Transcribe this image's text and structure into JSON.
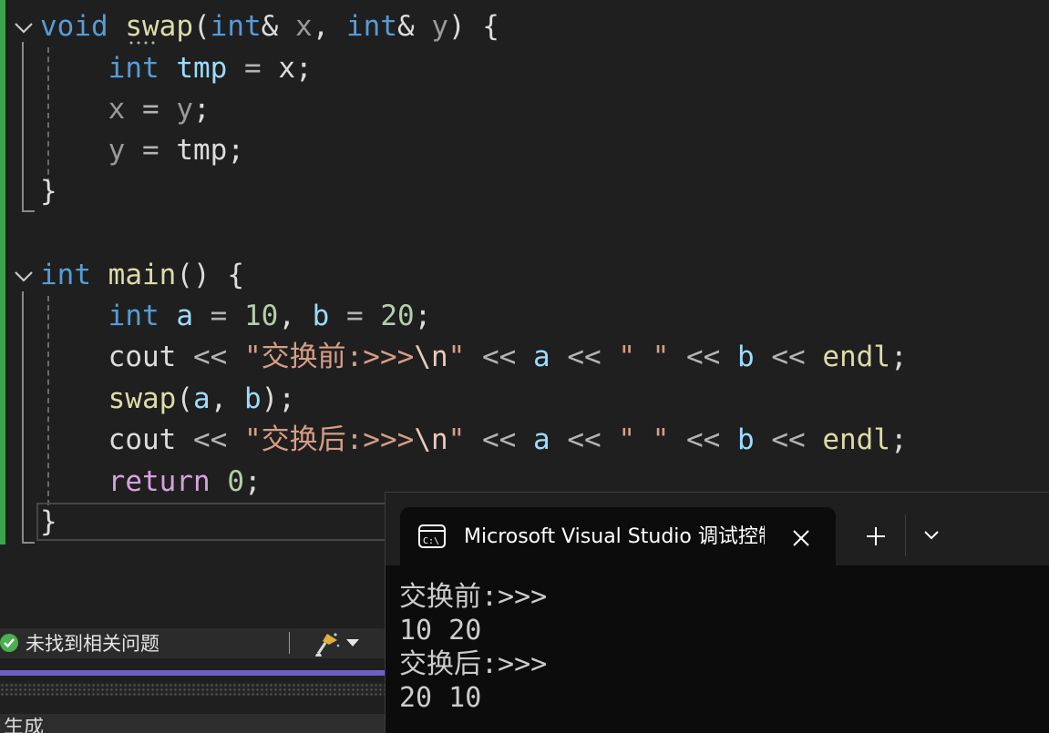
{
  "editor": {
    "lines": [
      {
        "segments": [
          {
            "cls": "kw",
            "text": "void"
          },
          {
            "cls": "",
            "text": " "
          },
          {
            "cls": "fn",
            "text": "swap"
          },
          {
            "cls": "",
            "text": "("
          },
          {
            "cls": "kw",
            "text": "int"
          },
          {
            "cls": "",
            "text": "& "
          },
          {
            "cls": "par",
            "text": "x"
          },
          {
            "cls": "",
            "text": ", "
          },
          {
            "cls": "kw",
            "text": "int"
          },
          {
            "cls": "",
            "text": "& "
          },
          {
            "cls": "par",
            "text": "y"
          },
          {
            "cls": "",
            "text": ") {"
          }
        ]
      },
      {
        "segments": [
          {
            "cls": "",
            "text": "    "
          },
          {
            "cls": "kw",
            "text": "int"
          },
          {
            "cls": "",
            "text": " "
          },
          {
            "cls": "var",
            "text": "tmp"
          },
          {
            "cls": "op",
            "text": " = "
          },
          {
            "cls": "",
            "text": "x;"
          }
        ]
      },
      {
        "segments": [
          {
            "cls": "",
            "text": "    "
          },
          {
            "cls": "par",
            "text": "x"
          },
          {
            "cls": "op",
            "text": " = "
          },
          {
            "cls": "par",
            "text": "y"
          },
          {
            "cls": "",
            "text": ";"
          }
        ]
      },
      {
        "segments": [
          {
            "cls": "",
            "text": "    "
          },
          {
            "cls": "par",
            "text": "y"
          },
          {
            "cls": "op",
            "text": " = "
          },
          {
            "cls": "",
            "text": "tmp;"
          }
        ]
      },
      {
        "segments": [
          {
            "cls": "",
            "text": "}"
          }
        ]
      },
      {
        "segments": [
          {
            "cls": "",
            "text": ""
          }
        ]
      },
      {
        "segments": [
          {
            "cls": "kw",
            "text": "int"
          },
          {
            "cls": "",
            "text": " "
          },
          {
            "cls": "fn",
            "text": "main"
          },
          {
            "cls": "",
            "text": "() {"
          }
        ]
      },
      {
        "segments": [
          {
            "cls": "",
            "text": "    "
          },
          {
            "cls": "kw",
            "text": "int"
          },
          {
            "cls": "",
            "text": " "
          },
          {
            "cls": "var",
            "text": "a"
          },
          {
            "cls": "op",
            "text": " = "
          },
          {
            "cls": "num",
            "text": "10"
          },
          {
            "cls": "",
            "text": ", "
          },
          {
            "cls": "var",
            "text": "b"
          },
          {
            "cls": "op",
            "text": " = "
          },
          {
            "cls": "num",
            "text": "20"
          },
          {
            "cls": "",
            "text": ";"
          }
        ]
      },
      {
        "segments": [
          {
            "cls": "",
            "text": "    cout "
          },
          {
            "cls": "op",
            "text": "<<"
          },
          {
            "cls": "",
            "text": " "
          },
          {
            "cls": "str",
            "text": "\"交换前:>>>"
          },
          {
            "cls": "esc",
            "text": "\\n"
          },
          {
            "cls": "str",
            "text": "\""
          },
          {
            "cls": "",
            "text": " "
          },
          {
            "cls": "op",
            "text": "<<"
          },
          {
            "cls": "",
            "text": " "
          },
          {
            "cls": "var",
            "text": "a"
          },
          {
            "cls": "",
            "text": " "
          },
          {
            "cls": "op",
            "text": "<<"
          },
          {
            "cls": "",
            "text": " "
          },
          {
            "cls": "str",
            "text": "\" \""
          },
          {
            "cls": "",
            "text": " "
          },
          {
            "cls": "op",
            "text": "<<"
          },
          {
            "cls": "",
            "text": " "
          },
          {
            "cls": "var",
            "text": "b"
          },
          {
            "cls": "",
            "text": " "
          },
          {
            "cls": "op",
            "text": "<<"
          },
          {
            "cls": "",
            "text": " "
          },
          {
            "cls": "fn",
            "text": "endl"
          },
          {
            "cls": "",
            "text": ";"
          }
        ]
      },
      {
        "segments": [
          {
            "cls": "",
            "text": "    "
          },
          {
            "cls": "fn",
            "text": "swap"
          },
          {
            "cls": "",
            "text": "("
          },
          {
            "cls": "var",
            "text": "a"
          },
          {
            "cls": "",
            "text": ", "
          },
          {
            "cls": "var",
            "text": "b"
          },
          {
            "cls": "",
            "text": ");"
          }
        ]
      },
      {
        "segments": [
          {
            "cls": "",
            "text": "    cout "
          },
          {
            "cls": "op",
            "text": "<<"
          },
          {
            "cls": "",
            "text": " "
          },
          {
            "cls": "str",
            "text": "\"交换后:>>>"
          },
          {
            "cls": "esc",
            "text": "\\n"
          },
          {
            "cls": "str",
            "text": "\""
          },
          {
            "cls": "",
            "text": " "
          },
          {
            "cls": "op",
            "text": "<<"
          },
          {
            "cls": "",
            "text": " "
          },
          {
            "cls": "var",
            "text": "a"
          },
          {
            "cls": "",
            "text": " "
          },
          {
            "cls": "op",
            "text": "<<"
          },
          {
            "cls": "",
            "text": " "
          },
          {
            "cls": "str",
            "text": "\" \""
          },
          {
            "cls": "",
            "text": " "
          },
          {
            "cls": "op",
            "text": "<<"
          },
          {
            "cls": "",
            "text": " "
          },
          {
            "cls": "var",
            "text": "b"
          },
          {
            "cls": "",
            "text": " "
          },
          {
            "cls": "op",
            "text": "<<"
          },
          {
            "cls": "",
            "text": " "
          },
          {
            "cls": "fn",
            "text": "endl"
          },
          {
            "cls": "",
            "text": ";"
          }
        ]
      },
      {
        "segments": [
          {
            "cls": "",
            "text": "    "
          },
          {
            "cls": "ret",
            "text": "return"
          },
          {
            "cls": "",
            "text": " "
          },
          {
            "cls": "num",
            "text": "0"
          },
          {
            "cls": "",
            "text": ";"
          }
        ]
      },
      {
        "segments": [
          {
            "cls": "",
            "text": "}"
          }
        ]
      }
    ]
  },
  "status": {
    "message": "未找到相关问题",
    "icons": [
      "check-icon",
      "brush-icon",
      "chevron-down-icon"
    ]
  },
  "bottom_panel": {
    "label": "生成"
  },
  "terminal": {
    "tab_title": "Microsoft Visual Studio 调试控制台",
    "output": [
      "交换前:>>>",
      "10 20",
      "交换后:>>>",
      "20 10"
    ]
  },
  "colors": {
    "editor_bg": "#1f1f1f",
    "keyword": "#569cd6",
    "function": "#dcdcaa",
    "string": "#d69d85",
    "number": "#b5cea8",
    "change_bar": "#3aa54a",
    "status_ok": "#4caf50",
    "accent_bar": "#6c5fc7",
    "terminal_bg": "#0c0c0c"
  }
}
